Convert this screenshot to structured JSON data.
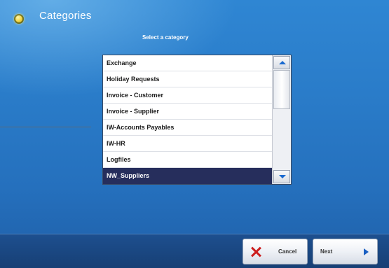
{
  "header": {
    "title": "Categories"
  },
  "subtitle": "Select a category",
  "list": {
    "items": [
      {
        "label": "Exchange",
        "selected": false
      },
      {
        "label": "Holiday Requests",
        "selected": false
      },
      {
        "label": "Invoice - Customer",
        "selected": false
      },
      {
        "label": "Invoice - Supplier",
        "selected": false
      },
      {
        "label": "IW-Accounts Payables",
        "selected": false
      },
      {
        "label": "IW-HR",
        "selected": false
      },
      {
        "label": "Logfiles",
        "selected": false
      },
      {
        "label": "NW_Suppliers",
        "selected": true
      }
    ]
  },
  "footer": {
    "cancel_label": "Cancel",
    "next_label": "Next"
  },
  "icons": {
    "status": "yellow-circle-icon",
    "cancel": "red-x-icon",
    "next": "play-arrow-icon",
    "scroll_up": "arrow-up-icon",
    "scroll_down": "arrow-down-icon"
  },
  "colors": {
    "background": "#2a7cc9",
    "selection": "#262e5c",
    "cancel_icon": "#cc1d1d",
    "next_icon": "#1a5fc2"
  }
}
